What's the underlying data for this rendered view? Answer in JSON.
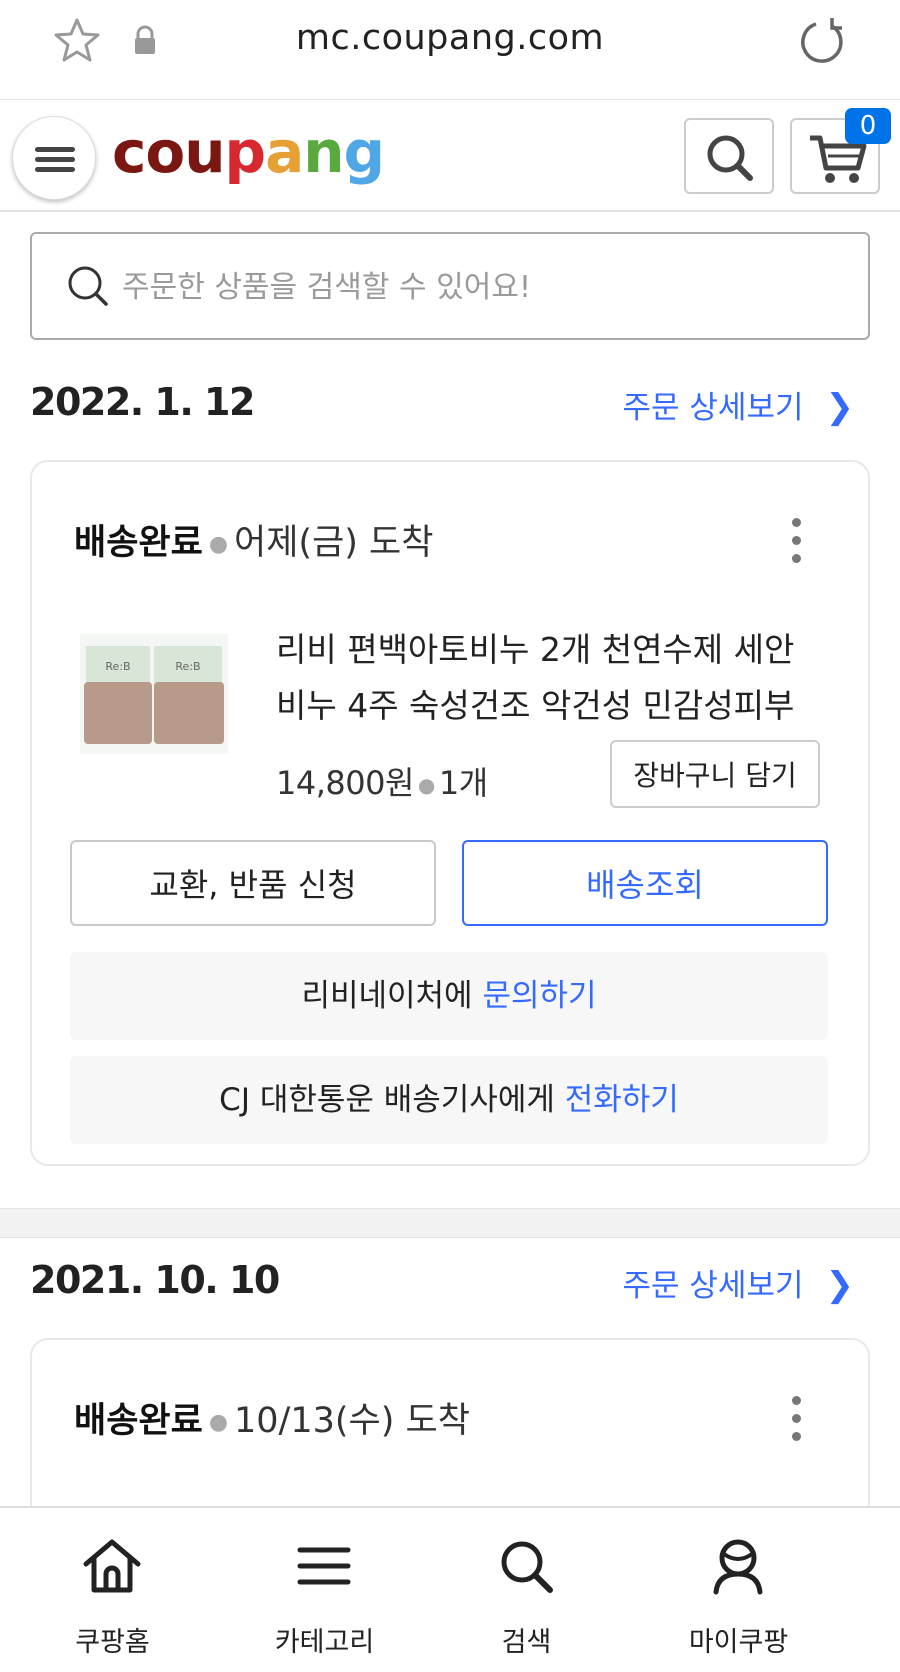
{
  "browser": {
    "url": "mc.coupang.com"
  },
  "header": {
    "logo": {
      "letters": [
        "c",
        "o",
        "u",
        "p",
        "a",
        "n",
        "g"
      ],
      "colors": [
        "#7a1713",
        "#7a1713",
        "#7a1713",
        "#d7282f",
        "#e7a034",
        "#59a93f",
        "#4fa7e6"
      ]
    },
    "cart_count": "0"
  },
  "search": {
    "placeholder": "주문한 상품을 검색할 수 있어요!"
  },
  "orders": [
    {
      "date": "2022. 1. 12",
      "detail_link": "주문 상세보기",
      "status": "배송완료",
      "arrival": "어제(금) 도착",
      "product_name": "리비 편백아토비누 2개 천연수제 세안비누 4주 숙성건조 악건성 민감성피부 (거...",
      "price": "14,800원",
      "quantity": "1개",
      "add_to_cart": "장바구니 담기",
      "exchange_button": "교환, 반품 신청",
      "track_button": "배송조회",
      "seller_prefix": "리비네이처에 ",
      "seller_action": "문의하기",
      "courier_prefix": "CJ 대한통운 배송기사에게 ",
      "courier_action": "전화하기",
      "product_thumb_text": "Re:B"
    },
    {
      "date": "2021. 10. 10",
      "detail_link": "주문 상세보기",
      "status": "배송완료",
      "arrival": "10/13(수) 도착"
    }
  ],
  "bottom_nav": [
    {
      "label": "쿠팡홈",
      "icon": "home-icon"
    },
    {
      "label": "카테고리",
      "icon": "menu-icon"
    },
    {
      "label": "검색",
      "icon": "search-icon"
    },
    {
      "label": "마이쿠팡",
      "icon": "user-icon"
    }
  ],
  "colors": {
    "accent": "#346aff",
    "badge": "#0073e9"
  }
}
